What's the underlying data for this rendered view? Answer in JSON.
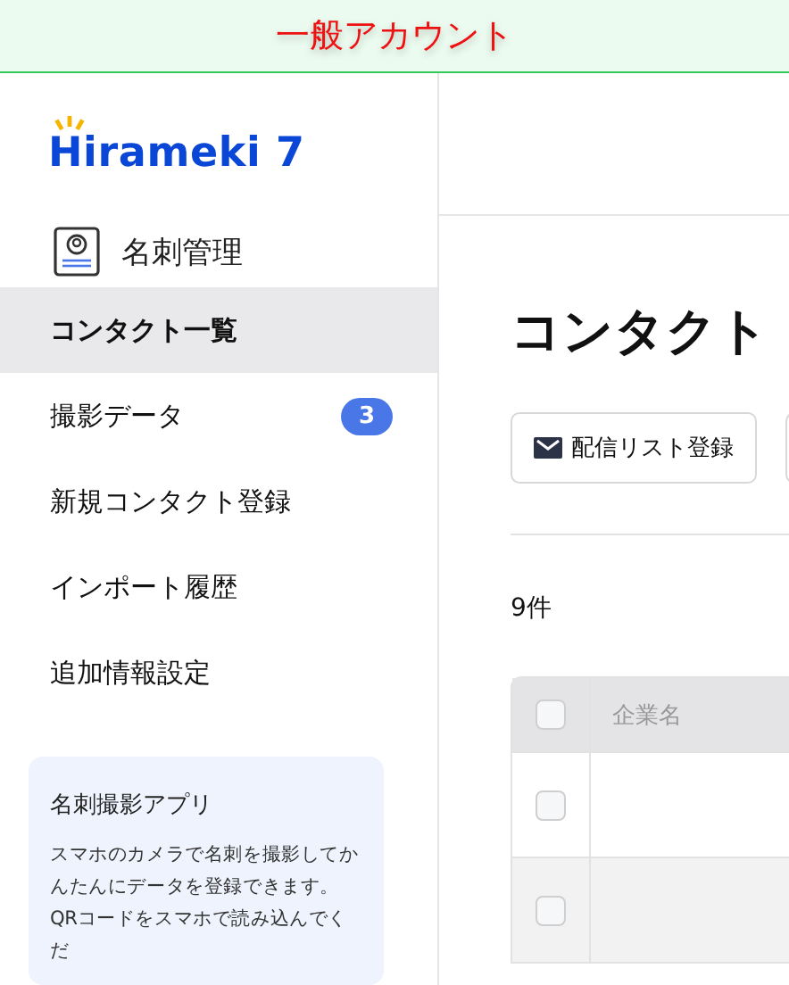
{
  "account_banner": {
    "label": "一般アカウント"
  },
  "sidebar": {
    "logo": "Hirameki 7",
    "section": "名刺管理",
    "items": [
      {
        "label": "コンタクト一覧",
        "selected": true
      },
      {
        "label": "撮影データ",
        "selected": false,
        "badge": "3"
      },
      {
        "label": "新規コンタクト登録",
        "selected": false
      },
      {
        "label": "インポート履歴",
        "selected": false
      },
      {
        "label": "追加情報設定",
        "selected": false
      }
    ],
    "promo": {
      "title": "名刺撮影アプリ",
      "text": "スマホのカメラで名刺を撮影してかんたんにデータを登録できます。QRコードをスマホで読み込んでくだ"
    }
  },
  "main": {
    "title": "コンタクト",
    "buttons": [
      {
        "label": "配信リスト登録"
      }
    ],
    "count": "9件",
    "table": {
      "header_checked": false,
      "columns": [
        "企業名"
      ],
      "rows": [
        {
          "checked": false
        },
        {
          "checked": false
        }
      ]
    }
  }
}
